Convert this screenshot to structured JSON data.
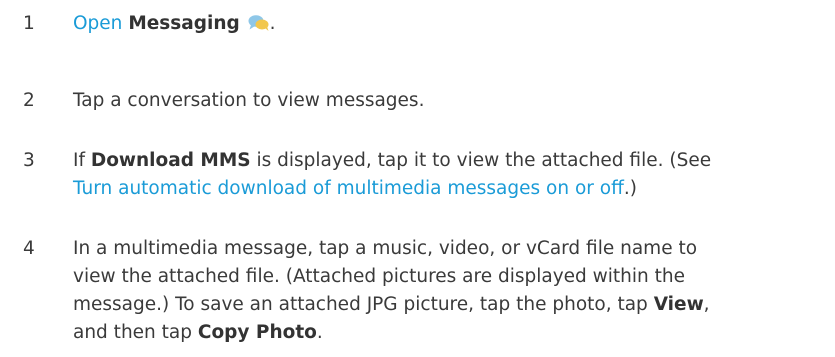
{
  "steps": [
    {
      "number": "1",
      "link": "Open",
      "app_name": "Messaging",
      "icon": "messaging-bubbles-icon",
      "end": "."
    },
    {
      "number": "2",
      "text": "Tap a conversation to view messages."
    },
    {
      "number": "3",
      "text_a": "If ",
      "bold": "Download MMS",
      "text_b": " is displayed, tap it to view the attached file. (See ",
      "link": "Turn automatic download of multimedia messages on or off",
      "text_c": ".)"
    },
    {
      "number": "4",
      "line1": "In a multimedia message, tap a music, video, or vCard file name to",
      "line2": "view the attached file. (Attached pictures are displayed within the",
      "line3a": "message.) To save an attached JPG picture, tap the photo, tap ",
      "bold1": "View",
      "line3b": ",",
      "line4a": "and then tap ",
      "bold2": "Copy Photo",
      "line4b": "."
    }
  ],
  "colors": {
    "link": "#1a9bd7",
    "text": "#3a3a3a"
  }
}
